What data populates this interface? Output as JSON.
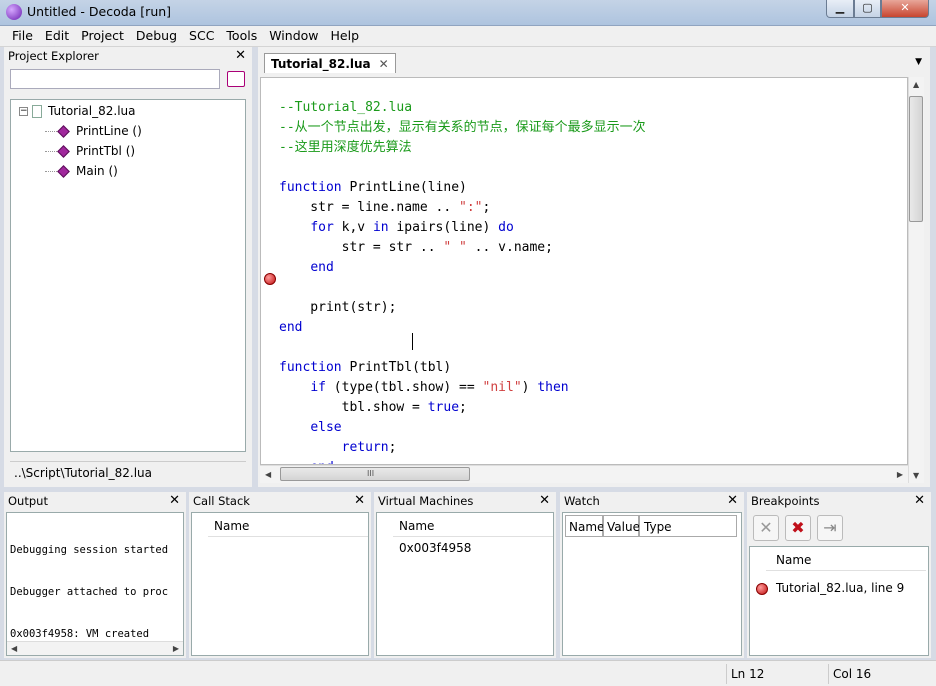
{
  "window": {
    "title": "Untitled - Decoda [run]",
    "minimize_glyph": "▁",
    "maximize_glyph": "▢",
    "close_glyph": "✕"
  },
  "menu": {
    "items": [
      "File",
      "Edit",
      "Project",
      "Debug",
      "SCC",
      "Tools",
      "Window",
      "Help"
    ]
  },
  "project_explorer": {
    "title": "Project Explorer",
    "search_value": "",
    "root": "Tutorial_82.lua",
    "functions": [
      "PrintLine ()",
      "PrintTbl ()",
      "Main ()"
    ],
    "path": "..\\Script\\Tutorial_82.lua"
  },
  "editor": {
    "tab_label": "Tutorial_82.lua",
    "tab_close": "✕",
    "dropdown_glyph": "▼",
    "scroll_up": "▲",
    "scroll_down": "▼",
    "scroll_left": "◀",
    "scroll_right": "▶",
    "thumb_grip": "III"
  },
  "code": [
    [
      {
        "t": "--Tutorial_82.lua",
        "c": "comment"
      }
    ],
    [
      {
        "t": "--从一个节点出发，显示有关系的节点，保证每个最多显示一次",
        "c": "comment"
      }
    ],
    [
      {
        "t": "--这里用深度优先算法",
        "c": "comment"
      }
    ],
    [],
    [
      {
        "t": "function",
        "c": "kw"
      },
      {
        "t": " PrintLine(line)",
        "c": ""
      }
    ],
    [
      {
        "t": "    str = line.name .. ",
        "c": ""
      },
      {
        "t": "\":\"",
        "c": "str"
      },
      {
        "t": ";",
        "c": ""
      }
    ],
    [
      {
        "t": "    ",
        "c": ""
      },
      {
        "t": "for",
        "c": "kw"
      },
      {
        "t": " k,v ",
        "c": ""
      },
      {
        "t": "in",
        "c": "kw"
      },
      {
        "t": " ipairs(line) ",
        "c": ""
      },
      {
        "t": "do",
        "c": "kw"
      }
    ],
    [
      {
        "t": "        str = str .. ",
        "c": ""
      },
      {
        "t": "\" \"",
        "c": "str"
      },
      {
        "t": " .. v.name;",
        "c": ""
      }
    ],
    [
      {
        "t": "    ",
        "c": ""
      },
      {
        "t": "end",
        "c": "kw"
      }
    ],
    [],
    [
      {
        "t": "    print(str);",
        "c": ""
      }
    ],
    [
      {
        "t": "end",
        "c": "kw"
      }
    ],
    [],
    [
      {
        "t": "function",
        "c": "kw"
      },
      {
        "t": " PrintTbl(tbl)",
        "c": ""
      }
    ],
    [
      {
        "t": "    ",
        "c": ""
      },
      {
        "t": "if",
        "c": "kw"
      },
      {
        "t": " (type(tbl.show) == ",
        "c": ""
      },
      {
        "t": "\"nil\"",
        "c": "str"
      },
      {
        "t": ") ",
        "c": ""
      },
      {
        "t": "then",
        "c": "kw"
      }
    ],
    [
      {
        "t": "        tbl.show = ",
        "c": ""
      },
      {
        "t": "true",
        "c": "kw"
      },
      {
        "t": ";",
        "c": ""
      }
    ],
    [
      {
        "t": "    ",
        "c": ""
      },
      {
        "t": "else",
        "c": "kw"
      }
    ],
    [
      {
        "t": "        ",
        "c": ""
      },
      {
        "t": "return",
        "c": "kw"
      },
      {
        "t": ";",
        "c": ""
      }
    ],
    [
      {
        "t": "    ",
        "c": ""
      },
      {
        "t": "end",
        "c": "kw"
      }
    ]
  ],
  "output": {
    "title": "Output",
    "lines": [
      "Debugging session started",
      "Debugger attached to proc",
      "0x003f4958: VM created"
    ]
  },
  "call_stack": {
    "title": "Call Stack",
    "col_name": "Name"
  },
  "virtual_machines": {
    "title": "Virtual Machines",
    "col_name": "Name",
    "rows": [
      "0x003f4958"
    ]
  },
  "watch": {
    "title": "Watch",
    "col_name": "Name",
    "col_value": "Value",
    "col_type": "Type"
  },
  "breakpoints": {
    "title": "Breakpoints",
    "col_name": "Name",
    "rows": [
      "Tutorial_82.lua, line 9"
    ],
    "delete_glyph": "✕",
    "delete_all_glyph": "✖",
    "goto_glyph": "⇥"
  },
  "status": {
    "line": "Ln 12",
    "col": "Col 16"
  },
  "close_glyph": "✕"
}
